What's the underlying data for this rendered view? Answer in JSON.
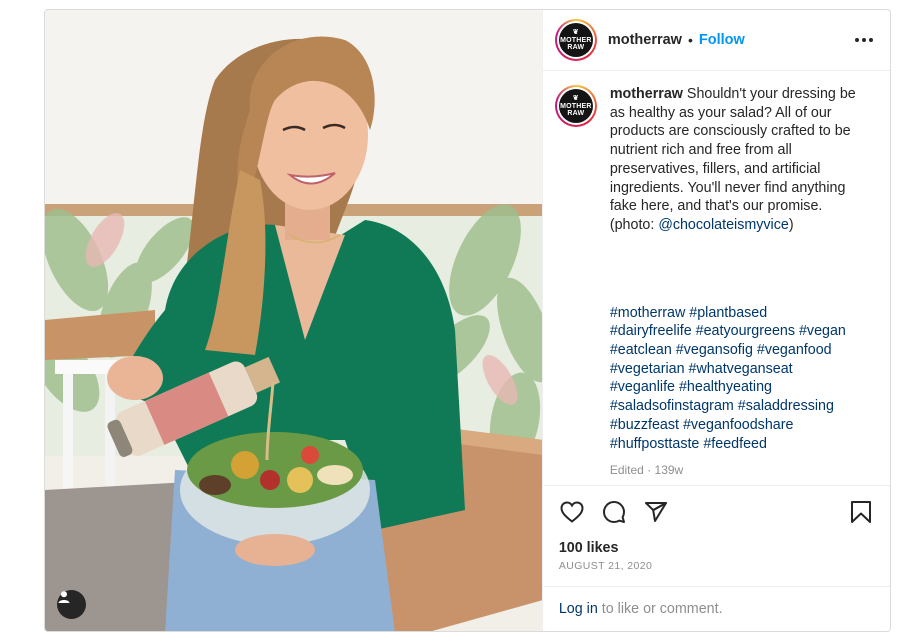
{
  "post": {
    "author": {
      "username": "motherraw",
      "avatar_text_line1": "MOTHER",
      "avatar_text_line2": "RAW"
    },
    "header": {
      "separator": "•",
      "follow_label": "Follow",
      "more_icon": "more-horizontal-icon"
    },
    "caption": {
      "username": "motherraw",
      "text": "Shouldn't your dressing be as healthy as your salad? All of our products are consciously crafted to be nutrient rich and free from all preservatives, fillers, and artificial ingredients. You'll never find anything fake here, and that's our promise. (photo: ",
      "mention": "@chocolateismyvice",
      "text_end": ")"
    },
    "hashtags": [
      "#motherraw #plantbased",
      "#dairyfreelife #eatyourgreens #vegan",
      "#eatclean #vegansofig #veganfood",
      "#vegetarian #whatveganseat",
      "#veganlife #healthyeating",
      "#saladsofinstagram #saladdressing",
      "#buzzfeast #veganfoodshare",
      "#huffposttaste #feedfeed"
    ],
    "caption_meta": "Edited · 139w",
    "actions": {
      "like_icon": "heart-icon",
      "comment_icon": "comment-icon",
      "share_icon": "share-icon",
      "save_icon": "bookmark-icon"
    },
    "likes": "100 likes",
    "date": "AUGUST 21, 2020",
    "login": {
      "link": "Log in",
      "rest": " to like or comment."
    }
  },
  "colors": {
    "accent": "#0095f6",
    "link": "#00376b",
    "muted": "#8e8e8e",
    "text": "#262626",
    "shirt": "#0f7a55"
  }
}
